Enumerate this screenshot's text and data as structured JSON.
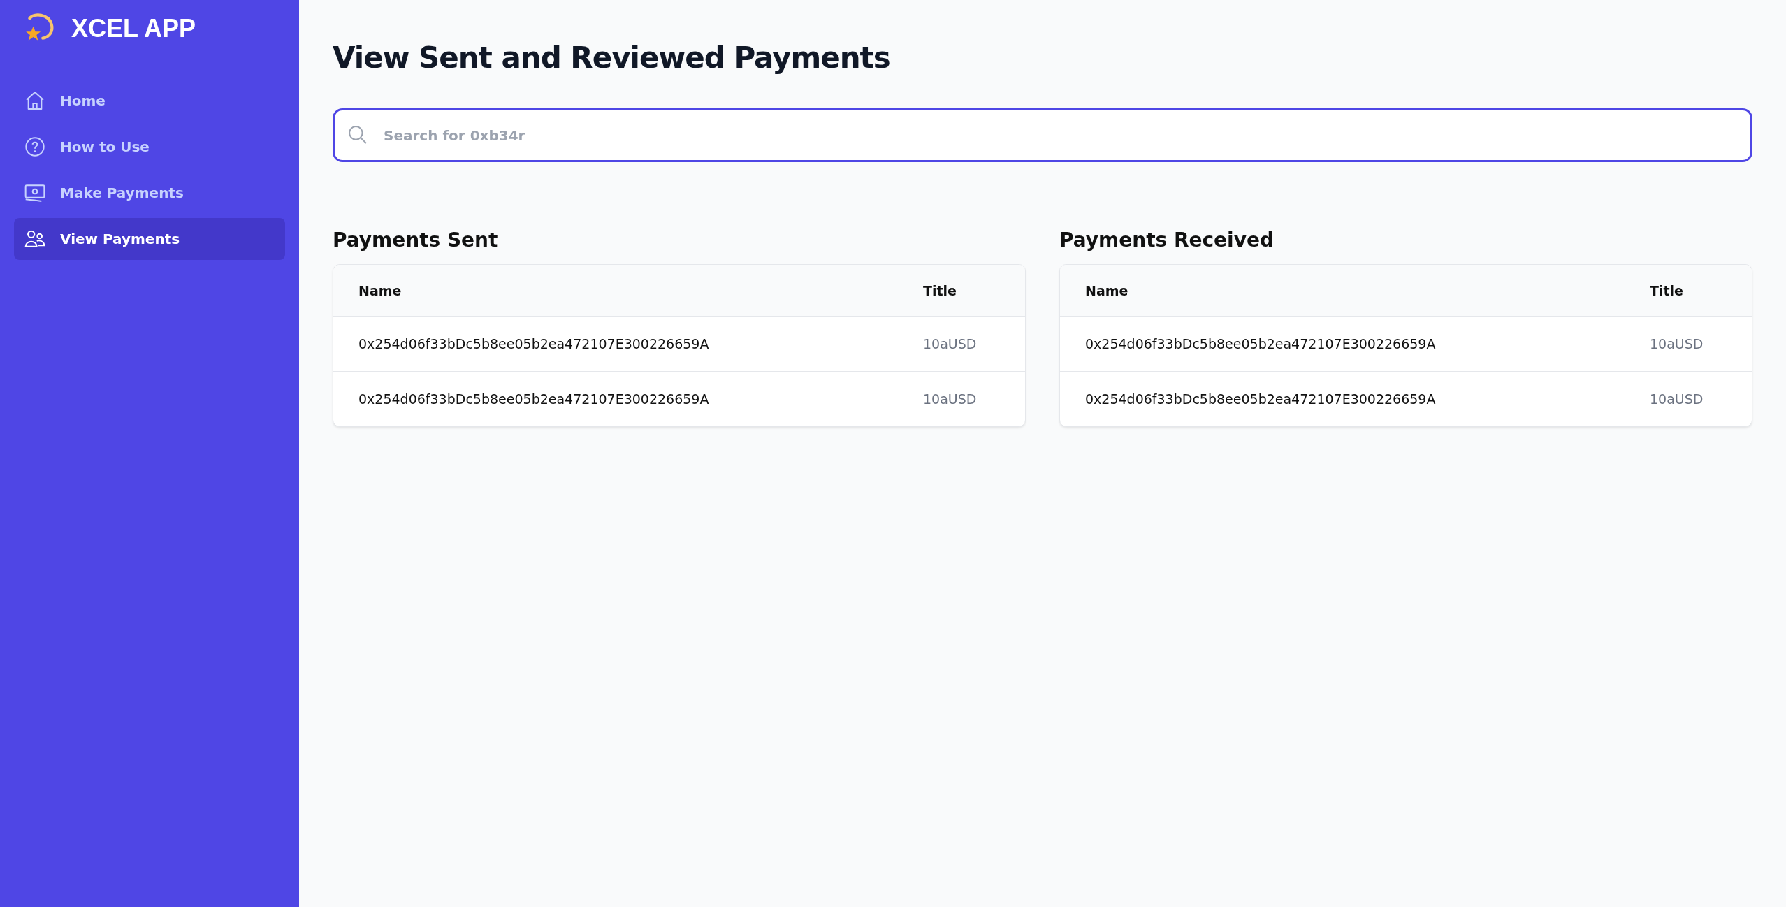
{
  "app": {
    "name": "XCEL APP"
  },
  "sidebar": {
    "items": [
      {
        "label": "Home",
        "selected": false
      },
      {
        "label": "How to Use",
        "selected": false
      },
      {
        "label": "Make Payments",
        "selected": false
      },
      {
        "label": "View Payments",
        "selected": true
      }
    ]
  },
  "page": {
    "title": "View Sent and Reviewed Payments"
  },
  "search": {
    "placeholder": "Search for 0xb34r"
  },
  "tables": [
    {
      "title": "Payments Sent",
      "columns": [
        "Name",
        "Title"
      ],
      "rows": [
        [
          "0x254d06f33bDc5b8ee05b2ea472107E300226659A",
          "10aUSD"
        ],
        [
          "0x254d06f33bDc5b8ee05b2ea472107E300226659A",
          "10aUSD"
        ]
      ]
    },
    {
      "title": "Payments Received",
      "columns": [
        "Name",
        "Title"
      ],
      "rows": [
        [
          "0x254d06f33bDc5b8ee05b2ea472107E300226659A",
          "10aUSD"
        ],
        [
          "0x254d06f33bDc5b8ee05b2ea472107E300226659A",
          "10aUSD"
        ]
      ]
    }
  ]
}
